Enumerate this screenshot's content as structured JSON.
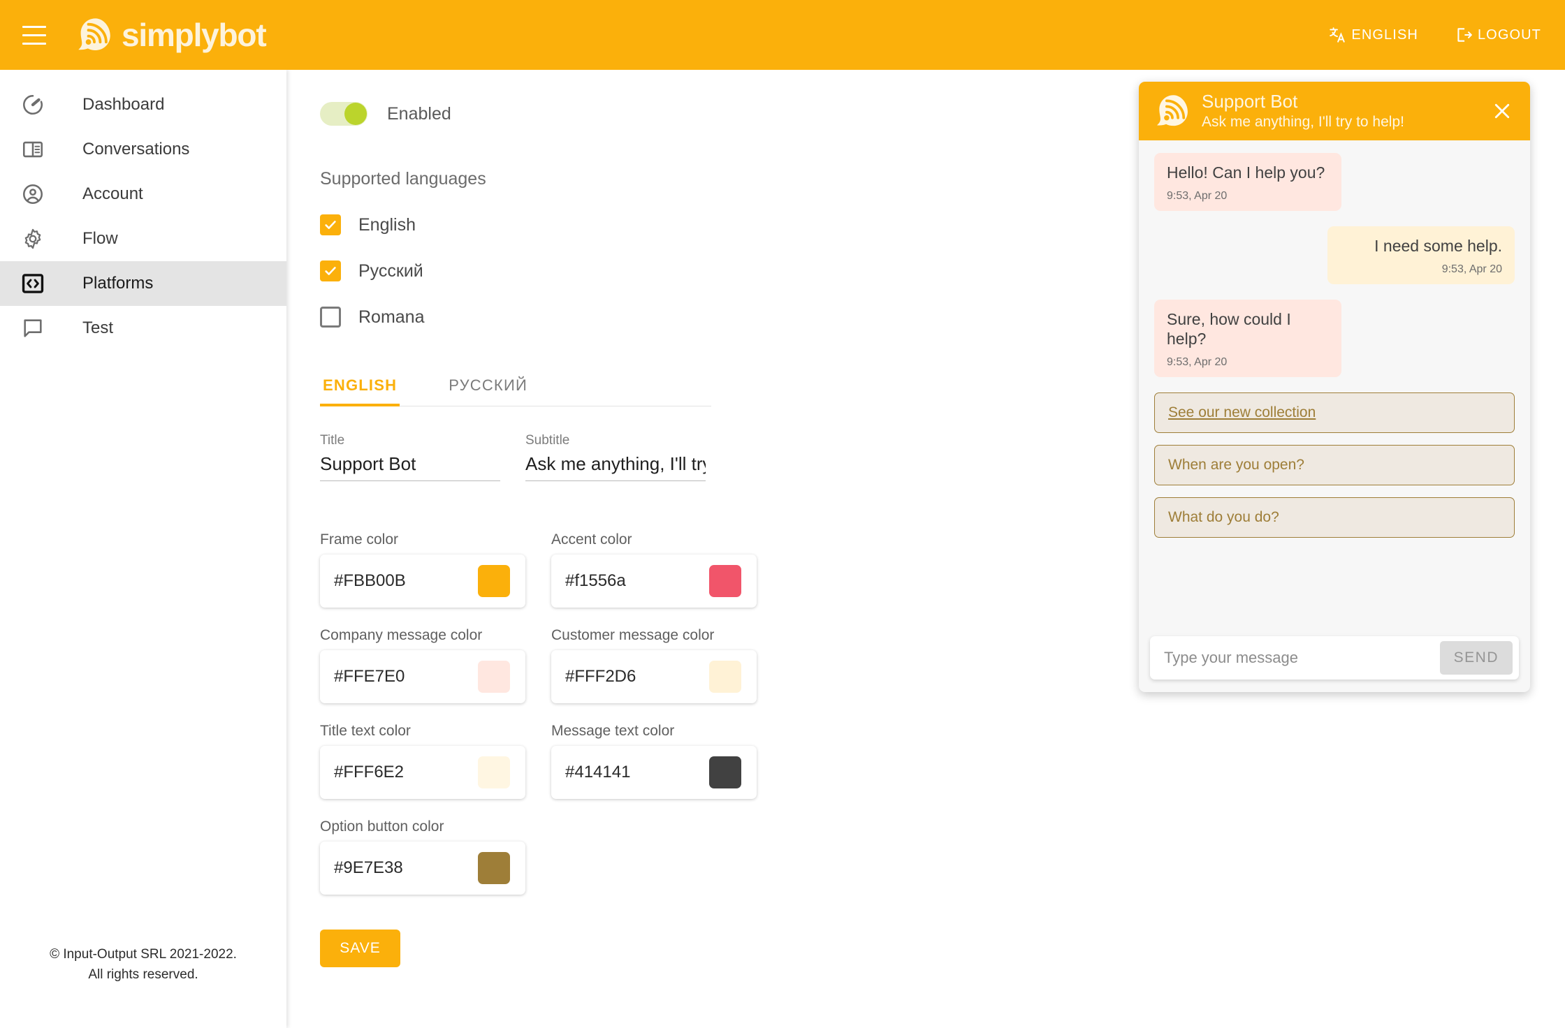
{
  "topbar": {
    "menu_icon": "hamburger-icon",
    "brand": "simplybot",
    "language_label": "ENGLISH",
    "language_icon": "translate-icon",
    "logout_label": "LOGOUT",
    "logout_icon": "logout-icon",
    "background_color": "#FBB00B"
  },
  "sidebar": {
    "items": [
      {
        "label": "Dashboard",
        "icon": "gauge-icon",
        "active": false
      },
      {
        "label": "Conversations",
        "icon": "book-icon",
        "active": false
      },
      {
        "label": "Account",
        "icon": "user-circle-icon",
        "active": false
      },
      {
        "label": "Flow",
        "icon": "gear-icon",
        "active": false
      },
      {
        "label": "Platforms",
        "icon": "code-brackets-icon",
        "active": true
      },
      {
        "label": "Test",
        "icon": "chat-bubble-icon",
        "active": false
      }
    ],
    "footer_line1": "© Input-Output SRL 2021-2022.",
    "footer_line2": "All rights reserved."
  },
  "form": {
    "enabled_label": "Enabled",
    "enabled_state": "on",
    "languages_label": "Supported languages",
    "languages": [
      {
        "label": "English",
        "checked": true
      },
      {
        "label": "Русский",
        "checked": true
      },
      {
        "label": "Romana",
        "checked": false
      }
    ],
    "tabs": [
      {
        "label": "ENGLISH",
        "active": true
      },
      {
        "label": "РУССКИЙ",
        "active": false
      }
    ],
    "title_field": {
      "label": "Title",
      "value": "Support Bot"
    },
    "subtitle_field": {
      "label": "Subtitle",
      "value": "Ask me anything, I'll try to help!"
    },
    "colors": [
      {
        "label": "Frame color",
        "value": "#FBB00B",
        "swatch": "#FBB00B"
      },
      {
        "label": "Accent color",
        "value": "#f1556a",
        "swatch": "#f1556a"
      },
      {
        "label": "Company message color",
        "value": "#FFE7E0",
        "swatch": "#FFE7E0"
      },
      {
        "label": "Customer message color",
        "value": "#FFF2D6",
        "swatch": "#FFF2D6"
      },
      {
        "label": "Title text color",
        "value": "#FFF6E2",
        "swatch": "#FFF6E2"
      },
      {
        "label": "Message text color",
        "value": "#414141",
        "swatch": "#414141"
      },
      {
        "label": "Option button color",
        "value": "#9E7E38",
        "swatch": "#9E7E38"
      }
    ],
    "save_label": "SAVE"
  },
  "chat": {
    "title": "Support Bot",
    "subtitle": "Ask me anything, I'll try to help!",
    "close_icon": "close-icon",
    "logo_icon": "simplybot-mark-icon",
    "messages": [
      {
        "from": "bot",
        "text": "Hello! Can I help you?",
        "time": "9:53, Apr 20"
      },
      {
        "from": "user",
        "text": "I need some help.",
        "time": "9:53, Apr 20"
      },
      {
        "from": "bot",
        "text": "Sure, how could I help?",
        "time": "9:53, Apr 20"
      }
    ],
    "options": [
      {
        "label": "See our new collection",
        "underlined": true
      },
      {
        "label": "When are you open?",
        "underlined": false
      },
      {
        "label": "What do you do?",
        "underlined": false
      }
    ],
    "input_placeholder": "Type your message",
    "input_value": "",
    "send_label": "SEND"
  }
}
